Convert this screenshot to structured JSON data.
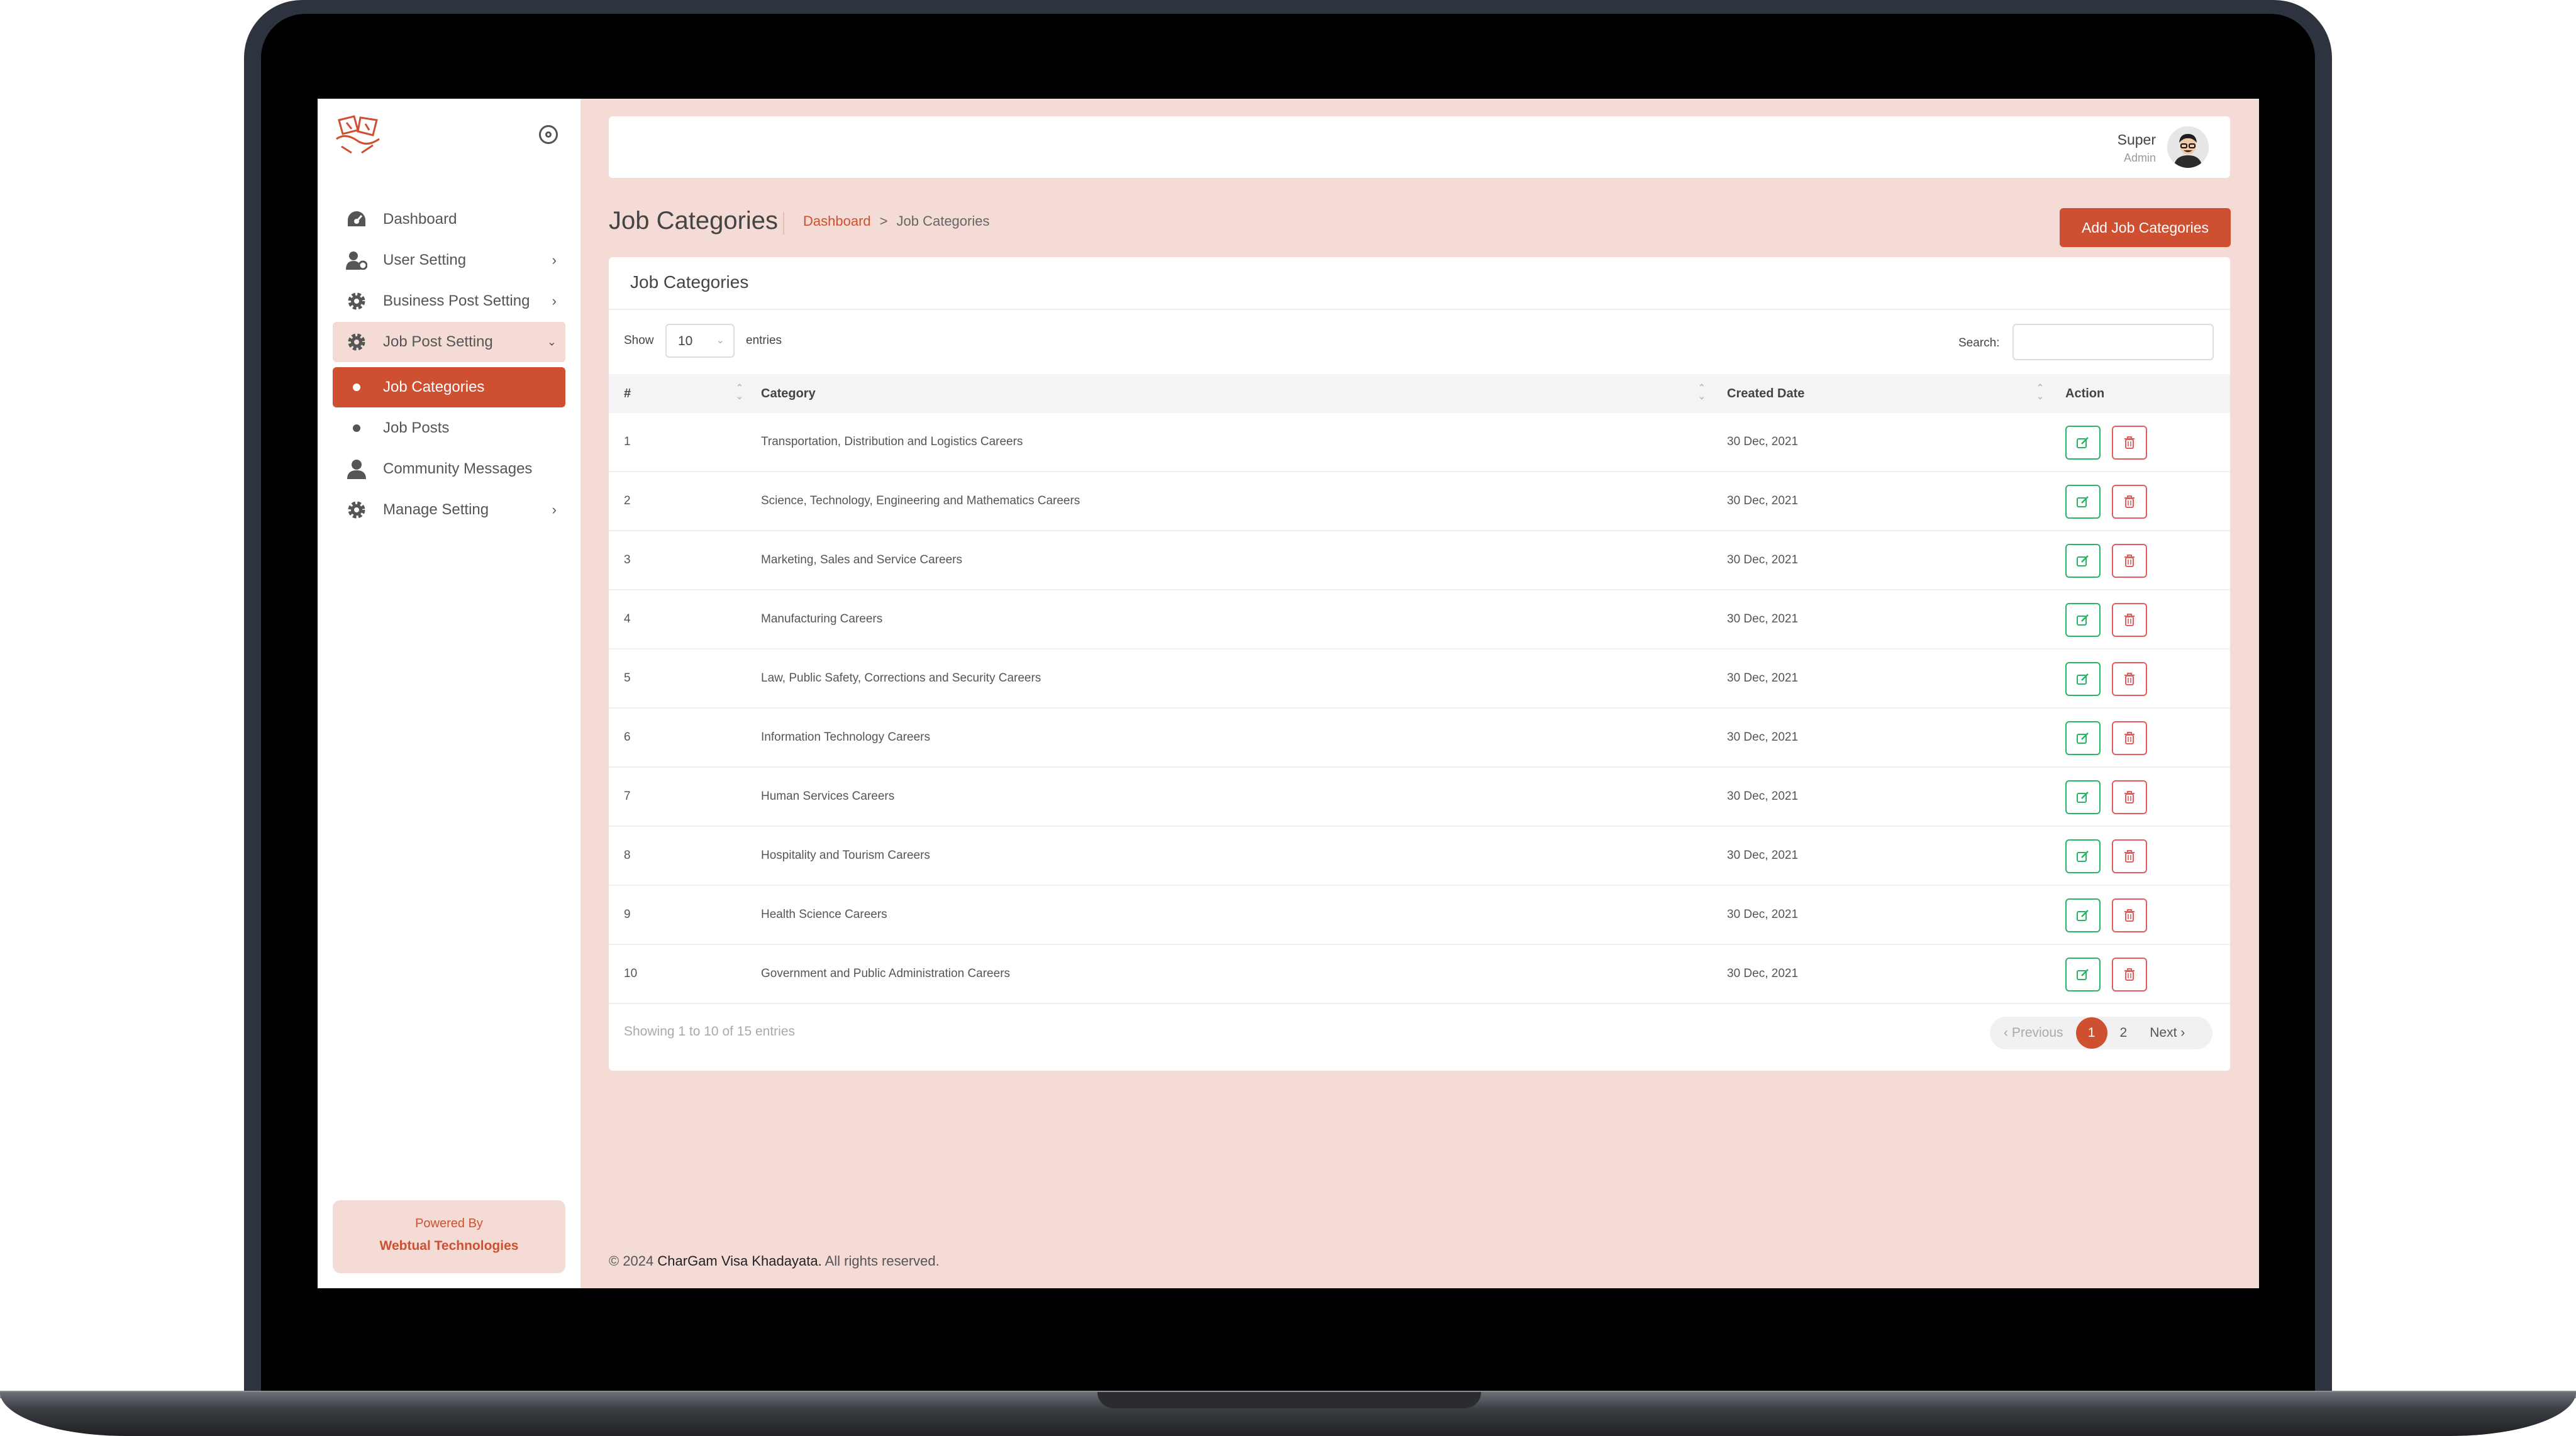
{
  "sidebar": {
    "items": [
      {
        "label": "Dashboard",
        "icon": "dashboard-icon"
      },
      {
        "label": "User Setting",
        "icon": "user-gear-icon"
      },
      {
        "label": "Business Post Setting",
        "icon": "gear-icon"
      },
      {
        "label": "Job Post Setting",
        "icon": "gear-icon"
      },
      {
        "label": "Job Categories",
        "icon": "bullet-icon"
      },
      {
        "label": "Job Posts",
        "icon": "bullet-icon"
      },
      {
        "label": "Community Messages",
        "icon": "user-icon"
      },
      {
        "label": "Manage Setting",
        "icon": "gear-icon"
      }
    ],
    "powered_by": "Powered By",
    "powered_company": "Webtual Technologies"
  },
  "header": {
    "user_name": "Super",
    "user_role": "Admin"
  },
  "page": {
    "title": "Job Categories",
    "breadcrumb": [
      "Dashboard",
      ">",
      "Job Categories"
    ],
    "add_button": "Add Job Categories"
  },
  "card": {
    "title": "Job Categories",
    "show_label": "Show",
    "page_size": "10",
    "entries_label": "entries",
    "search_label": "Search:",
    "columns": [
      "#",
      "Category",
      "Created Date",
      "Action"
    ],
    "rows": [
      {
        "no": "1",
        "category": "Transportation, Distribution and Logistics Careers",
        "date": "30 Dec, 2021"
      },
      {
        "no": "2",
        "category": "Science, Technology, Engineering and Mathematics Careers",
        "date": "30 Dec, 2021"
      },
      {
        "no": "3",
        "category": "Marketing, Sales and Service Careers",
        "date": "30 Dec, 2021"
      },
      {
        "no": "4",
        "category": "Manufacturing Careers",
        "date": "30 Dec, 2021"
      },
      {
        "no": "5",
        "category": "Law, Public Safety, Corrections and Security Careers",
        "date": "30 Dec, 2021"
      },
      {
        "no": "6",
        "category": "Information Technology Careers",
        "date": "30 Dec, 2021"
      },
      {
        "no": "7",
        "category": "Human Services Careers",
        "date": "30 Dec, 2021"
      },
      {
        "no": "8",
        "category": "Hospitality and Tourism Careers",
        "date": "30 Dec, 2021"
      },
      {
        "no": "9",
        "category": "Health Science Careers",
        "date": "30 Dec, 2021"
      },
      {
        "no": "10",
        "category": "Government and Public Administration Careers",
        "date": "30 Dec, 2021"
      }
    ],
    "info": "Showing 1 to 10 of 15 entries",
    "pager": {
      "prev": "‹ Previous",
      "p1": "1",
      "p2": "2",
      "next": "Next ›"
    }
  },
  "footer": {
    "prefix": "© 2024 ",
    "brand": "CharGam Visa Khadayata.",
    "suffix": " All rights reserved."
  },
  "colors": {
    "accent": "#cf5030",
    "background": "#f4dbd5",
    "edit": "#28b463",
    "delete": "#e35d5d"
  }
}
